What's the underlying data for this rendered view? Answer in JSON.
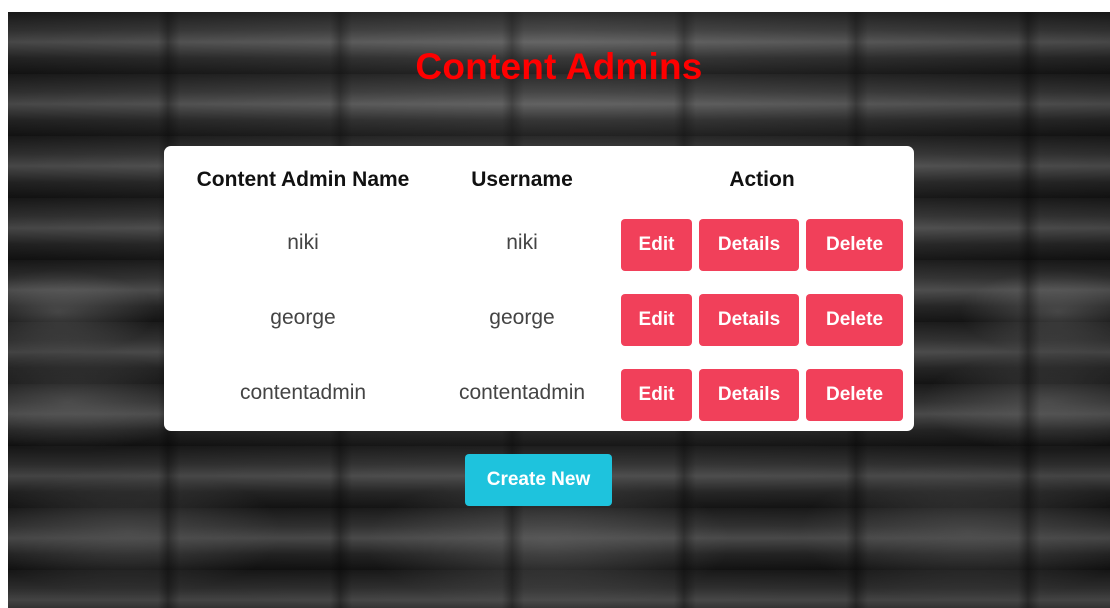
{
  "page": {
    "title": "Content Admins",
    "title_color": "#ff0000"
  },
  "table": {
    "headers": {
      "name": "Content Admin Name",
      "username": "Username",
      "action": "Action"
    },
    "rows": [
      {
        "name": "niki",
        "username": "niki"
      },
      {
        "name": "george",
        "username": "george"
      },
      {
        "name": "contentadmin",
        "username": "contentadmin"
      }
    ],
    "actions": {
      "edit": "Edit",
      "details": "Details",
      "delete": "Delete"
    },
    "action_color": "#f1405a"
  },
  "create": {
    "label": "Create New",
    "color": "#1ec3dd"
  }
}
